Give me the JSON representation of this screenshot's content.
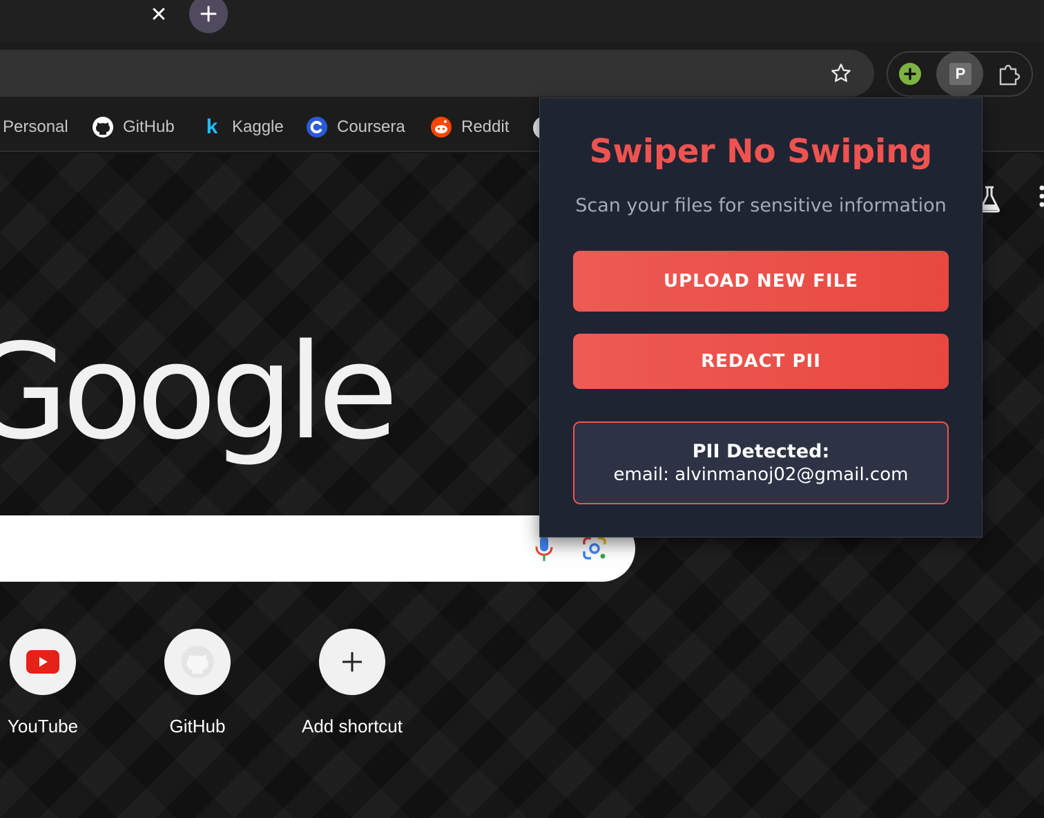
{
  "browser": {
    "tab_close_glyph": "✕",
    "new_tab_glyph": "+",
    "extensions": {
      "p_extension_letter": "P"
    }
  },
  "bookmarks": [
    {
      "label": "Personal",
      "icon": "folder-icon"
    },
    {
      "label": "GitHub",
      "icon": "github-icon"
    },
    {
      "label": "Kaggle",
      "icon": "kaggle-icon"
    },
    {
      "label": "Coursera",
      "icon": "coursera-icon"
    },
    {
      "label": "Reddit",
      "icon": "reddit-icon"
    }
  ],
  "ntp": {
    "logo_text": "Google",
    "shortcuts": [
      {
        "label": "YouTube",
        "icon": "youtube-icon"
      },
      {
        "label": "GitHub",
        "icon": "github-icon"
      },
      {
        "label": "Add shortcut",
        "icon": "plus-icon"
      }
    ]
  },
  "popup": {
    "title": "Swiper No Swiping",
    "subtitle": "Scan your files for sensitive information",
    "upload_label": "UPLOAD NEW FILE",
    "redact_label": "REDACT PII",
    "pii_title": "PII Detected:",
    "pii_line": "email: alvinmanoj02@gmail.com"
  },
  "colors": {
    "accent_red": "#ef5350",
    "popup_bg": "#1f2433",
    "pii_box_bg": "#2d3345"
  }
}
